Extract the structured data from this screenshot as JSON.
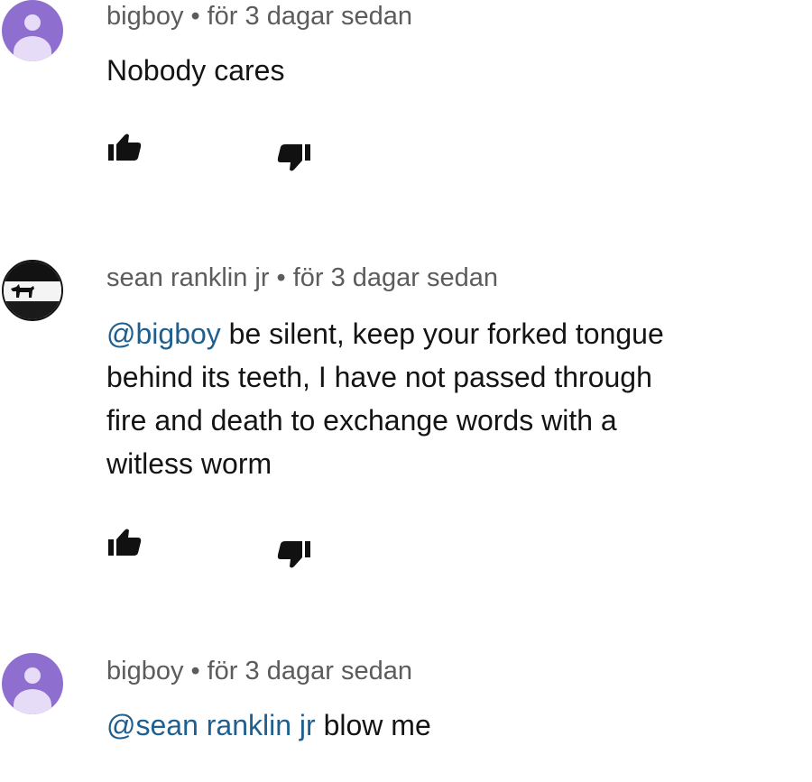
{
  "comments": [
    {
      "author": "bigboy",
      "separator": "•",
      "time": "för 3 dagar sedan",
      "mention": "",
      "text": "Nobody cares",
      "avatar_color": "#8e6fcf"
    },
    {
      "author": "sean ranklin jr",
      "separator": "•",
      "time": "för 3 dagar sedan",
      "mention": "@bigboy",
      "text_lines": [
        " be silent, keep your forked tongue",
        "behind its teeth, I have not passed through",
        "fire and death to exchange words with a",
        "witless worm"
      ]
    },
    {
      "author": "bigboy",
      "separator": "•",
      "time": "för 3 dagar sedan",
      "mention": "@sean ranklin jr",
      "text": " blow me",
      "avatar_color": "#8e6fcf"
    }
  ],
  "colors": {
    "mention": "#1f5f8f",
    "meta": "#5c5c5c",
    "icon": "#111111"
  },
  "icons": {
    "like": "thumbs-up-icon",
    "dislike": "thumbs-down-icon"
  }
}
